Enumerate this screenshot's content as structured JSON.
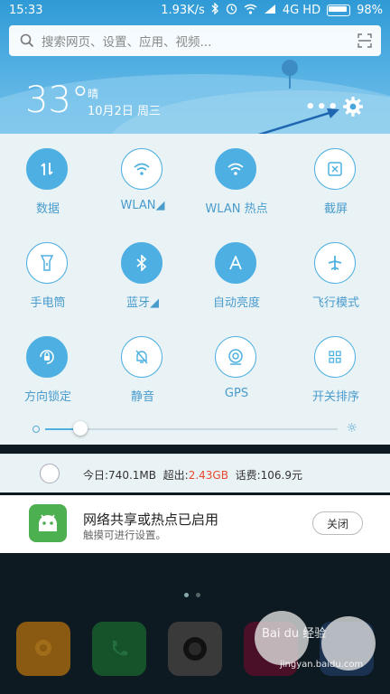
{
  "status_bar": {
    "time": "15:33",
    "speed": "1.93K/s",
    "network": "4G HD",
    "battery": "98%"
  },
  "search": {
    "placeholder": "搜索网页、设置、应用、视频..."
  },
  "weather": {
    "temperature": "33°",
    "condition": "晴",
    "date": "10月2日 周三",
    "more_label": "•••"
  },
  "toggles": [
    {
      "label": "数据",
      "icon": "data-arrows-icon",
      "on": true
    },
    {
      "label": "WLAN◢",
      "icon": "wifi-icon",
      "on": false
    },
    {
      "label": "WLAN 热点",
      "icon": "hotspot-icon",
      "on": true
    },
    {
      "label": "截屏",
      "icon": "screenshot-icon",
      "on": false
    },
    {
      "label": "手电筒",
      "icon": "flashlight-icon",
      "on": false
    },
    {
      "label": "蓝牙◢",
      "icon": "bluetooth-icon",
      "on": true
    },
    {
      "label": "自动亮度",
      "icon": "auto-brightness-icon",
      "on": true
    },
    {
      "label": "飞行模式",
      "icon": "airplane-icon",
      "on": false
    },
    {
      "label": "方向锁定",
      "icon": "rotation-lock-icon",
      "on": true
    },
    {
      "label": "静音",
      "icon": "mute-bell-icon",
      "on": false
    },
    {
      "label": "GPS",
      "icon": "gps-icon",
      "on": false
    },
    {
      "label": "开关排序",
      "icon": "sort-grid-icon",
      "on": false
    }
  ],
  "brightness": {
    "level": 0.12
  },
  "usage": {
    "today_label": "今日:",
    "today_value": "740.1MB",
    "over_label": "超出:",
    "over_value": "2.43GB",
    "fee_label": "话费:",
    "fee_value": "106.9元"
  },
  "notification": {
    "title": "网络共享或热点已启用",
    "subtitle": "触摸可进行设置。",
    "close_label": "关闭"
  },
  "watermark": {
    "brand": "Bai du 经验",
    "site": "jingyan.baidu.com"
  },
  "colors": {
    "accent": "#4fb0e0",
    "sky": "#3a9fd8",
    "panel": "#e9f2f5",
    "over": "#e8492f"
  }
}
